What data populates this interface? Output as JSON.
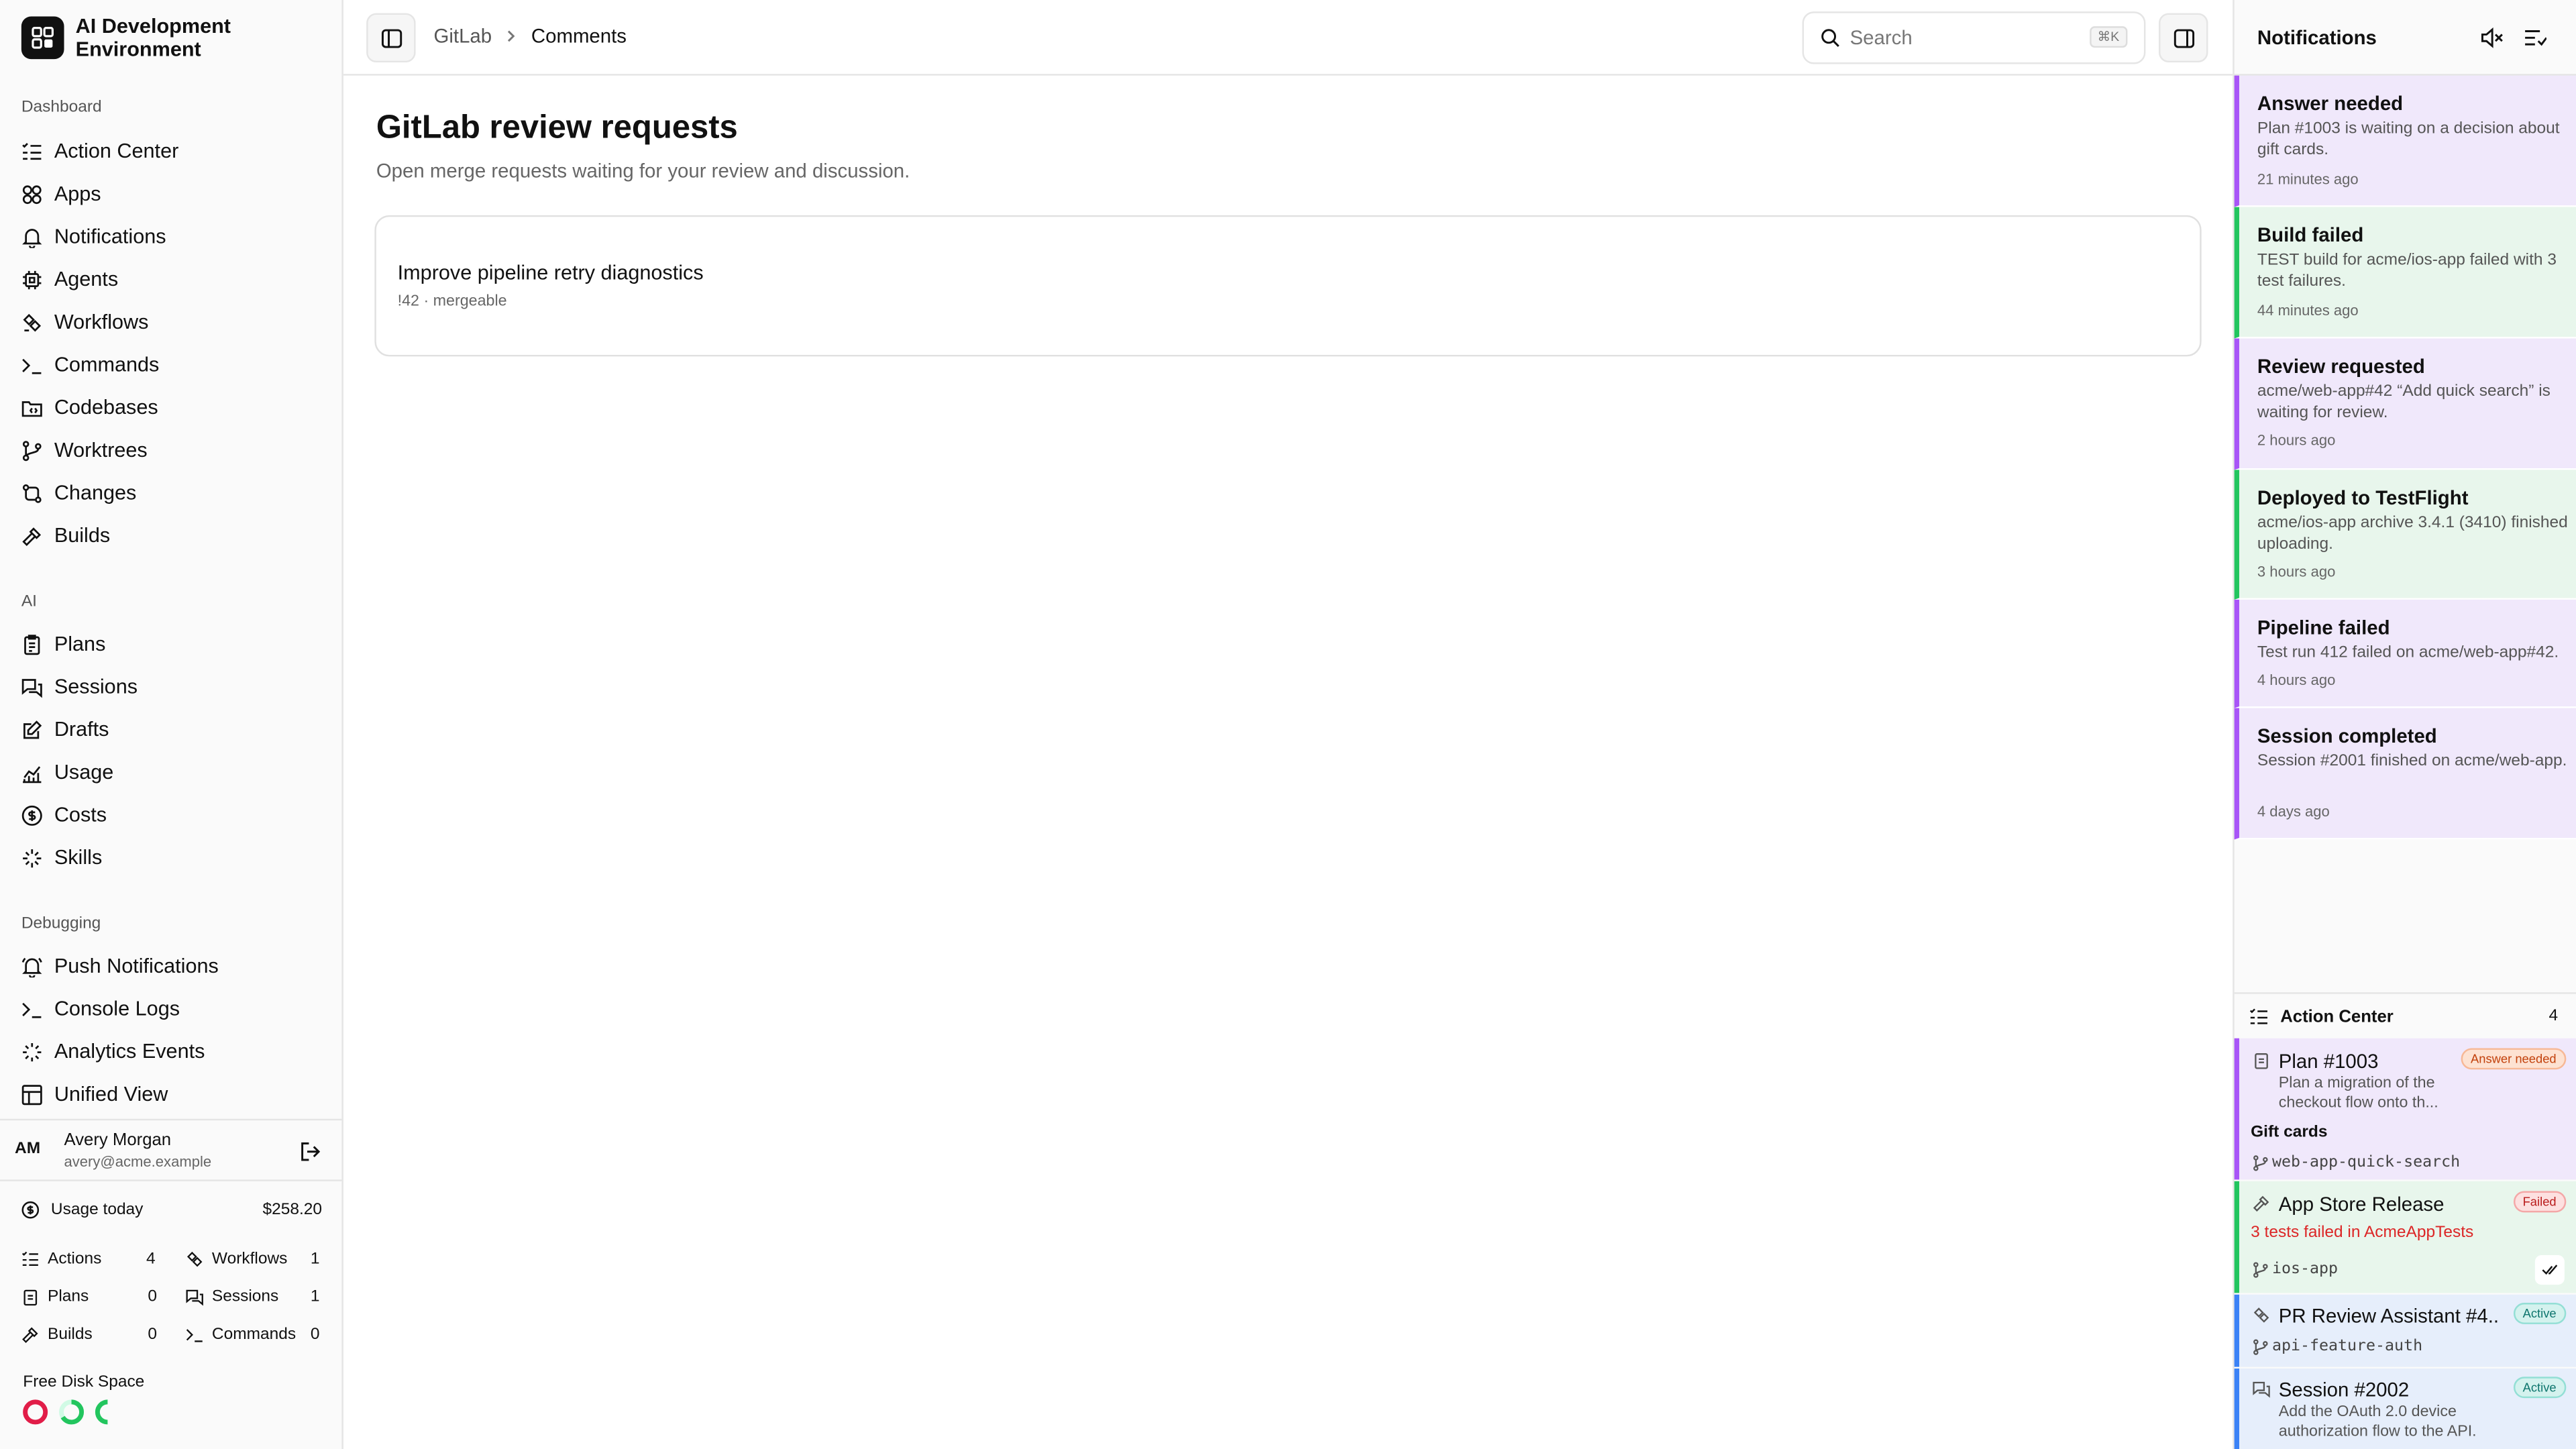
{
  "app": {
    "title": "AI Development Environment"
  },
  "sidebar": {
    "sections": [
      {
        "title": "Dashboard",
        "items": [
          {
            "label": "Action Center",
            "icon": "list-check-icon"
          },
          {
            "label": "Apps",
            "icon": "apps-icon"
          },
          {
            "label": "Notifications",
            "icon": "bell-icon"
          },
          {
            "label": "Agents",
            "icon": "cpu-icon"
          },
          {
            "label": "Workflows",
            "icon": "workflow-icon"
          },
          {
            "label": "Commands",
            "icon": "terminal-icon"
          },
          {
            "label": "Codebases",
            "icon": "folder-icon"
          },
          {
            "label": "Worktrees",
            "icon": "git-branch-icon"
          },
          {
            "label": "Changes",
            "icon": "git-compare-icon"
          },
          {
            "label": "Builds",
            "icon": "hammer-icon"
          }
        ]
      },
      {
        "title": "AI",
        "items": [
          {
            "label": "Plans",
            "icon": "clipboard-icon"
          },
          {
            "label": "Sessions",
            "icon": "chat-icon"
          },
          {
            "label": "Drafts",
            "icon": "edit-icon"
          },
          {
            "label": "Usage",
            "icon": "chart-icon"
          },
          {
            "label": "Costs",
            "icon": "dollar-icon"
          },
          {
            "label": "Skills",
            "icon": "sparkle-icon"
          }
        ]
      },
      {
        "title": "Debugging",
        "items": [
          {
            "label": "Push Notifications",
            "icon": "bell-ring-icon"
          },
          {
            "label": "Console Logs",
            "icon": "terminal-icon"
          },
          {
            "label": "Analytics Events",
            "icon": "activity-icon"
          },
          {
            "label": "Unified View",
            "icon": "layout-icon"
          }
        ]
      }
    ],
    "user": {
      "initials": "AM",
      "name": "Avery Morgan",
      "email": "avery@acme.example"
    },
    "usage": {
      "label": "Usage today",
      "amount": "$258.20",
      "stats": [
        {
          "label": "Actions",
          "value": "4"
        },
        {
          "label": "Workflows",
          "value": "1"
        },
        {
          "label": "Plans",
          "value": "0"
        },
        {
          "label": "Sessions",
          "value": "1"
        },
        {
          "label": "Builds",
          "value": "0"
        },
        {
          "label": "Commands",
          "value": "0"
        }
      ]
    },
    "disk": {
      "title": "Free Disk Space",
      "colors": [
        "#e11d48",
        "#22c55e",
        "#22c55e"
      ]
    }
  },
  "topbar": {
    "breadcrumb": [
      "GitLab",
      "Comments"
    ],
    "search_placeholder": "Search",
    "search_shortcut": "⌘K"
  },
  "main": {
    "title": "GitLab review requests",
    "subtitle": "Open merge requests waiting for your review and discussion.",
    "merge_requests": [
      {
        "title": "Improve pipeline retry diagnostics",
        "meta": "!42 · mergeable"
      }
    ]
  },
  "notifications": {
    "title": "Notifications",
    "items": [
      {
        "title": "Answer needed",
        "body": "Plan #1003 is waiting on a decision about gift cards.",
        "time": "21 minutes ago",
        "color": "purple"
      },
      {
        "title": "Build failed",
        "body": "TEST build for acme/ios-app failed with 3 test failures.",
        "time": "44 minutes ago",
        "color": "green"
      },
      {
        "title": "Review requested",
        "body": "acme/web-app#42 “Add quick search” is waiting for review.",
        "time": "2 hours ago",
        "color": "purple"
      },
      {
        "title": "Deployed to TestFlight",
        "body": "acme/ios-app archive 3.4.1 (3410) finished uploading.",
        "time": "3 hours ago",
        "color": "green"
      },
      {
        "title": "Pipeline failed",
        "body": "Test run 412 failed on acme/web-app#42.",
        "time": "4 hours ago",
        "color": "purple"
      },
      {
        "title": "Session completed",
        "body": "Session #2001 finished on acme/web-app.",
        "time": "4 days ago",
        "color": "purple"
      }
    ]
  },
  "action_center": {
    "title": "Action Center",
    "count": "4",
    "cards": [
      {
        "title": "Plan #1003",
        "badge": "Answer needed",
        "desc": "Plan a migration of the checkout flow onto th...",
        "extra": "Gift cards",
        "branch": "web-app-quick-search"
      },
      {
        "title": "App Store Release",
        "badge": "Failed",
        "error": "3 tests failed in AcmeAppTests",
        "branch": "ios-app"
      },
      {
        "title": "PR Review Assistant #4...",
        "badge": "Active",
        "branch": "api-feature-auth"
      },
      {
        "title": "Session #2002",
        "badge": "Active",
        "desc": "Add the OAuth 2.0 device authorization flow to the API."
      }
    ]
  }
}
